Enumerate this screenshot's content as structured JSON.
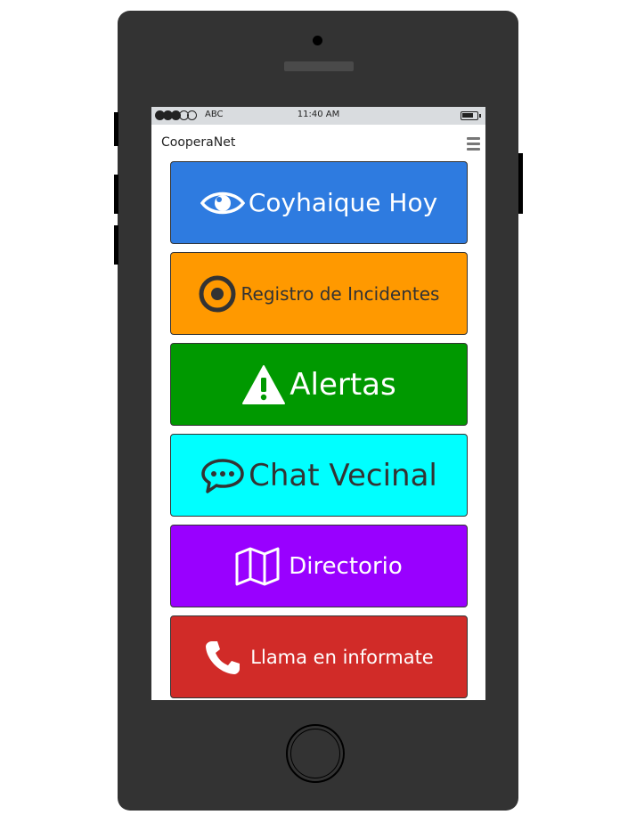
{
  "status_bar": {
    "carrier": "ABC",
    "time": "11:40 AM"
  },
  "app": {
    "title": "CooperaNet"
  },
  "menu": [
    {
      "label": "Coyhaique Hoy",
      "icon": "eye-icon",
      "bg": "#2e7be0",
      "fg": "#ffffff"
    },
    {
      "label": "Registro de Incidentes",
      "icon": "target-icon",
      "bg": "#ff9900",
      "fg": "#333333"
    },
    {
      "label": "Alertas",
      "icon": "warning-icon",
      "bg": "#009900",
      "fg": "#ffffff"
    },
    {
      "label": "Chat Vecinal",
      "icon": "chat-icon",
      "bg": "#00ffff",
      "fg": "#333333"
    },
    {
      "label": "Directorio",
      "icon": "map-icon",
      "bg": "#9900ff",
      "fg": "#ffffff"
    },
    {
      "label": "Llama en informate",
      "icon": "phone-icon",
      "bg": "#d12b28",
      "fg": "#ffffff"
    }
  ]
}
